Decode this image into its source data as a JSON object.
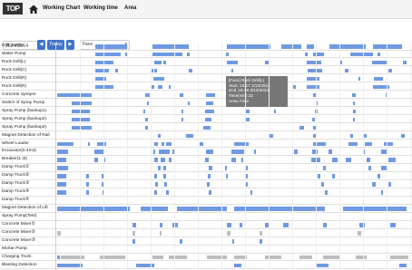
{
  "header": {
    "logo": "TOP",
    "nav": [
      {
        "label": "Working Chart"
      },
      {
        "label": "Working time"
      },
      {
        "label": "Area"
      }
    ]
  },
  "toolbar": {
    "date": "2024/03/14",
    "prev_label": "◀",
    "today_label": "Today",
    "next_label": "▶",
    "area_value": "Face",
    "area_chevron": "▾"
  },
  "colors": {
    "bar_blue": "#6f9ae3",
    "bar_gray": "#bdbdbd",
    "accent": "#3f74c9"
  },
  "rows": [
    {
      "label": "Drill Jumbo"
    },
    {
      "label": "Water Pump"
    },
    {
      "label": "Rock Drill(L)"
    },
    {
      "label": "Rock Drill(C)"
    },
    {
      "label": "Rock Drill(R)"
    },
    {
      "label": "Rock Drill(R)"
    },
    {
      "label": "Concrete Sprayer"
    },
    {
      "label": "Switch of Spray Pump"
    },
    {
      "label": "Spray Pump (backup1)"
    },
    {
      "label": "Spray Pump (backup2)"
    },
    {
      "label": "Spray Pump (backup3)"
    },
    {
      "label": "Magnet Detection of Rail"
    },
    {
      "label": "Wheel Loader"
    },
    {
      "label": "Excavator(0.4m3)"
    },
    {
      "label": "Breaker(1.3t)"
    },
    {
      "label": "Damp Truck①"
    },
    {
      "label": "Damp Truck②"
    },
    {
      "label": "Damp Truck③"
    },
    {
      "label": "Damp Truck④"
    },
    {
      "label": "Damp Truck⑤"
    },
    {
      "label": "Magnet Detection of Lift"
    },
    {
      "label": "Spray Pump(Test)"
    },
    {
      "label": "Concrete Mixer①"
    },
    {
      "label": "Concrete Mixer②"
    },
    {
      "label": "Concrete Mixer③"
    },
    {
      "label": "Mortar Pump"
    },
    {
      "label": "Charging Truck"
    },
    {
      "label": "Blasting Detection"
    }
  ],
  "tooltip": {
    "title": "[Face]  Rock Drill(L)",
    "start": "Start :18:17  3/13/2024",
    "end": "End  :18:49  3/13/2024",
    "time": "Time(min) 32",
    "area": "Area:  Face"
  }
}
